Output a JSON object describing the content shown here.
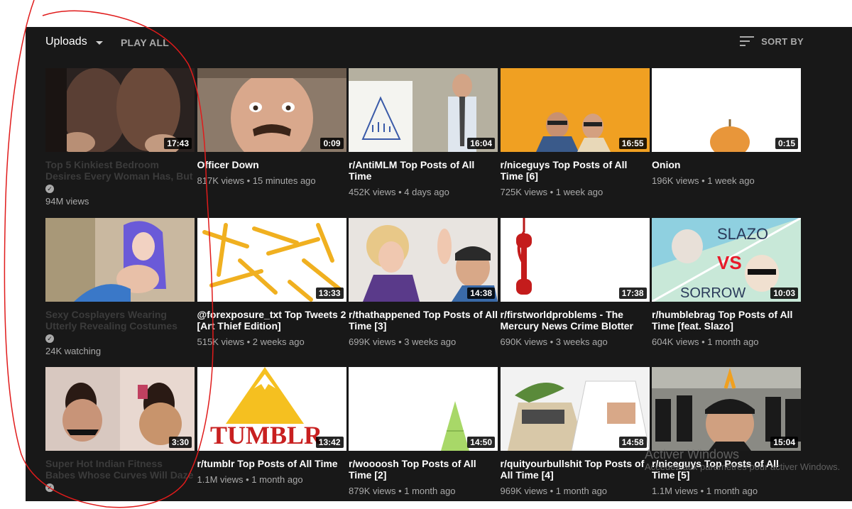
{
  "header": {
    "uploads_label": "Uploads",
    "play_all_label": "PLAY ALL",
    "sort_label": "SORT BY"
  },
  "videos": [
    {
      "title": "Top 5 Kinkiest Bedroom Desires Every Woman Has, But",
      "meta": "94M views",
      "duration": "17:43",
      "verified": true
    },
    {
      "title": "Officer Down",
      "meta": "817K views • 15 minutes ago",
      "duration": "0:09"
    },
    {
      "title": "r/AntiMLM Top Posts of All Time",
      "meta": "452K views • 4 days ago",
      "duration": "16:04"
    },
    {
      "title": "r/niceguys Top Posts of All Time [6]",
      "meta": "725K views • 1 week ago",
      "duration": "16:55"
    },
    {
      "title": "Onion",
      "meta": "196K views • 1 week ago",
      "duration": "0:15"
    },
    {
      "title": "Sexy Cosplayers Wearing Utterly Revealing Costumes",
      "meta": "24K watching",
      "duration": "",
      "verified": true
    },
    {
      "title": "@forexposure_txt Top Tweets 2 [Art Thief Edition]",
      "meta": "515K views • 2 weeks ago",
      "duration": "13:33"
    },
    {
      "title": "r/thathappened Top Posts of All Time [3]",
      "meta": "699K views • 3 weeks ago",
      "duration": "14:38"
    },
    {
      "title": "r/firstworldproblems - The Mercury News Crime Blotter",
      "meta": "690K views • 3 weeks ago",
      "duration": "17:38"
    },
    {
      "title": "r/humblebrag Top Posts of All Time [feat. Slazo]",
      "meta": "604K views • 1 month ago",
      "duration": "10:03",
      "thumb_text": [
        "SLAZO",
        "VS",
        "SORROW"
      ]
    },
    {
      "title": "Super Hot Indian Fitness Babes Whose Curves Will Daze",
      "meta": "",
      "duration": "3:30",
      "verified": true
    },
    {
      "title": "r/tumblr Top Posts of All Time",
      "meta": "1.1M views • 1 month ago",
      "duration": "13:42",
      "thumb_text": [
        "TUMBLR"
      ]
    },
    {
      "title": "r/woooosh Top Posts of All Time [2]",
      "meta": "879K views • 1 month ago",
      "duration": "14:50"
    },
    {
      "title": "r/quityourbullshit Top Posts of All Time [4]",
      "meta": "969K views • 1 month ago",
      "duration": "14:58"
    },
    {
      "title": "r/niceguys Top Posts of All Time [5]",
      "meta": "1.1M views • 1 month ago",
      "duration": "15:04"
    }
  ],
  "watermark": {
    "line1": "Activer Windows",
    "line2": "Accédez aux paramètres pour activer Windows."
  },
  "colors": {
    "background": "#181818",
    "text_primary": "#ffffff",
    "text_secondary": "#aaaaaa",
    "annotation": "#e01b1b"
  }
}
